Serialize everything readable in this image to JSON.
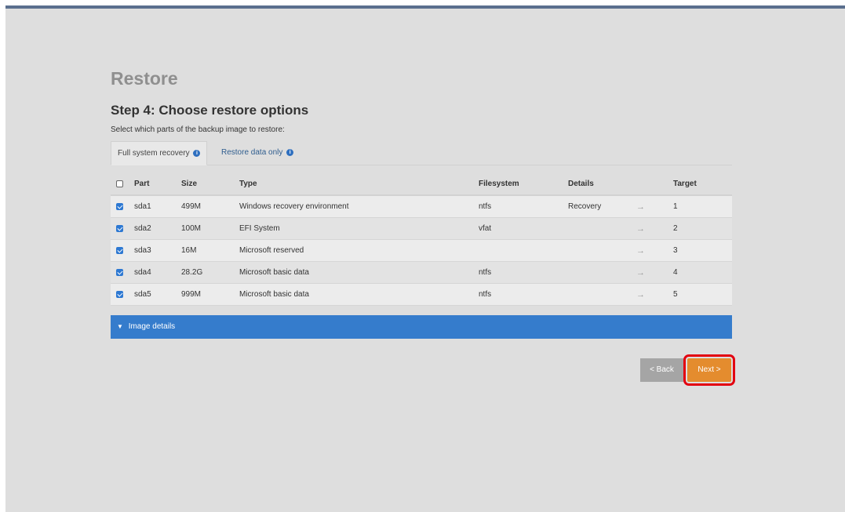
{
  "page": {
    "title": "Restore",
    "step_title": "Step 4: Choose restore options",
    "subtitle": "Select which parts of the backup image to restore:"
  },
  "tabs": [
    {
      "label": "Full system recovery",
      "active": true,
      "icon": "info-icon"
    },
    {
      "label": "Restore data only",
      "active": false,
      "icon": "info-icon"
    }
  ],
  "table": {
    "headers": {
      "part": "Part",
      "size": "Size",
      "type": "Type",
      "filesystem": "Filesystem",
      "details": "Details",
      "target": "Target"
    },
    "select_all_checked": false,
    "arrow": "→",
    "rows": [
      {
        "checked": true,
        "part": "sda1",
        "size": "499M",
        "type": "Windows recovery environment",
        "filesystem": "ntfs",
        "details": "Recovery",
        "target": "1"
      },
      {
        "checked": true,
        "part": "sda2",
        "size": "100M",
        "type": "EFI System",
        "filesystem": "vfat",
        "details": "",
        "target": "2"
      },
      {
        "checked": true,
        "part": "sda3",
        "size": "16M",
        "type": "Microsoft reserved",
        "filesystem": "",
        "details": "",
        "target": "3"
      },
      {
        "checked": true,
        "part": "sda4",
        "size": "28.2G",
        "type": "Microsoft basic data",
        "filesystem": "ntfs",
        "details": "",
        "target": "4"
      },
      {
        "checked": true,
        "part": "sda5",
        "size": "999M",
        "type": "Microsoft basic data",
        "filesystem": "ntfs",
        "details": "",
        "target": "5"
      }
    ]
  },
  "image_details": {
    "label": "Image details",
    "icon": "chevron-down-icon"
  },
  "buttons": {
    "back": "< Back",
    "next": "Next >"
  },
  "colors": {
    "accent_blue": "#357ccc",
    "next_orange": "#e48c2e",
    "highlight_red": "#e30010",
    "back_gray": "#a5a5a5"
  }
}
